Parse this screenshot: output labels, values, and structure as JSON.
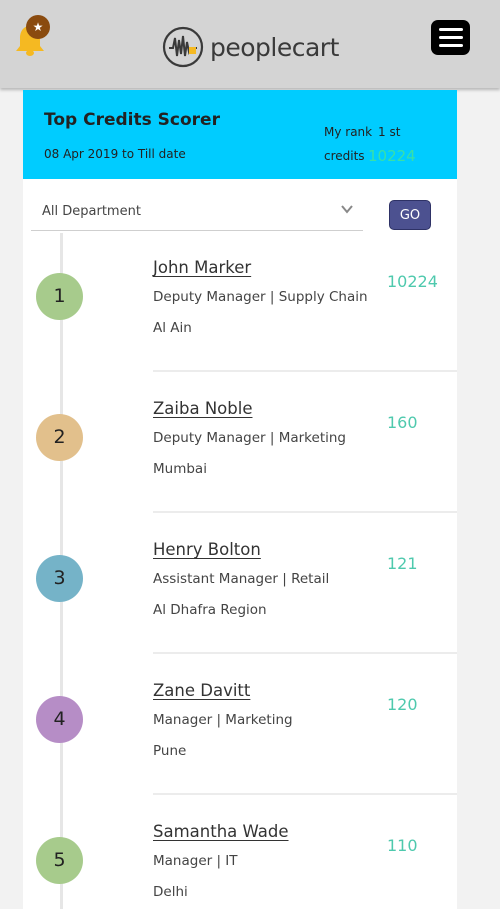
{
  "header": {
    "brand": "peoplecart",
    "notification_badge": "★",
    "icons": {
      "bell": "bell-icon",
      "menu": "hamburger-menu-icon",
      "logo": "waveform-logo-icon"
    }
  },
  "banner": {
    "title": "Top Credits Scorer",
    "date_range": "08 Apr 2019 to Till date",
    "rank_label": "My rank",
    "rank_value": "1 st",
    "credits_label": "credits",
    "credits_value": "10224",
    "background": "#00ccff"
  },
  "filter": {
    "selected": "All Department",
    "go_label": "GO"
  },
  "leaderboard": [
    {
      "rank": "1",
      "name": "John Marker",
      "role": "Deputy Manager | Supply Chain",
      "location": "Al Ain",
      "score": "10224",
      "color": "#a7cb8c"
    },
    {
      "rank": "2",
      "name": "Zaiba Noble",
      "role": "Deputy Manager | Marketing",
      "location": "Mumbai",
      "score": "160",
      "color": "#e2c08c"
    },
    {
      "rank": "3",
      "name": "Henry Bolton",
      "role": "Assistant Manager | Retail",
      "location": "Al Dhafra Region",
      "score": "121",
      "color": "#75b3c8"
    },
    {
      "rank": "4",
      "name": "Zane Davitt",
      "role": "Manager | Marketing",
      "location": "Pune",
      "score": "120",
      "color": "#b68dc6"
    },
    {
      "rank": "5",
      "name": "Samantha Wade",
      "role": "Manager | IT",
      "location": "Delhi",
      "score": "110",
      "color": "#a7cb8c"
    }
  ]
}
